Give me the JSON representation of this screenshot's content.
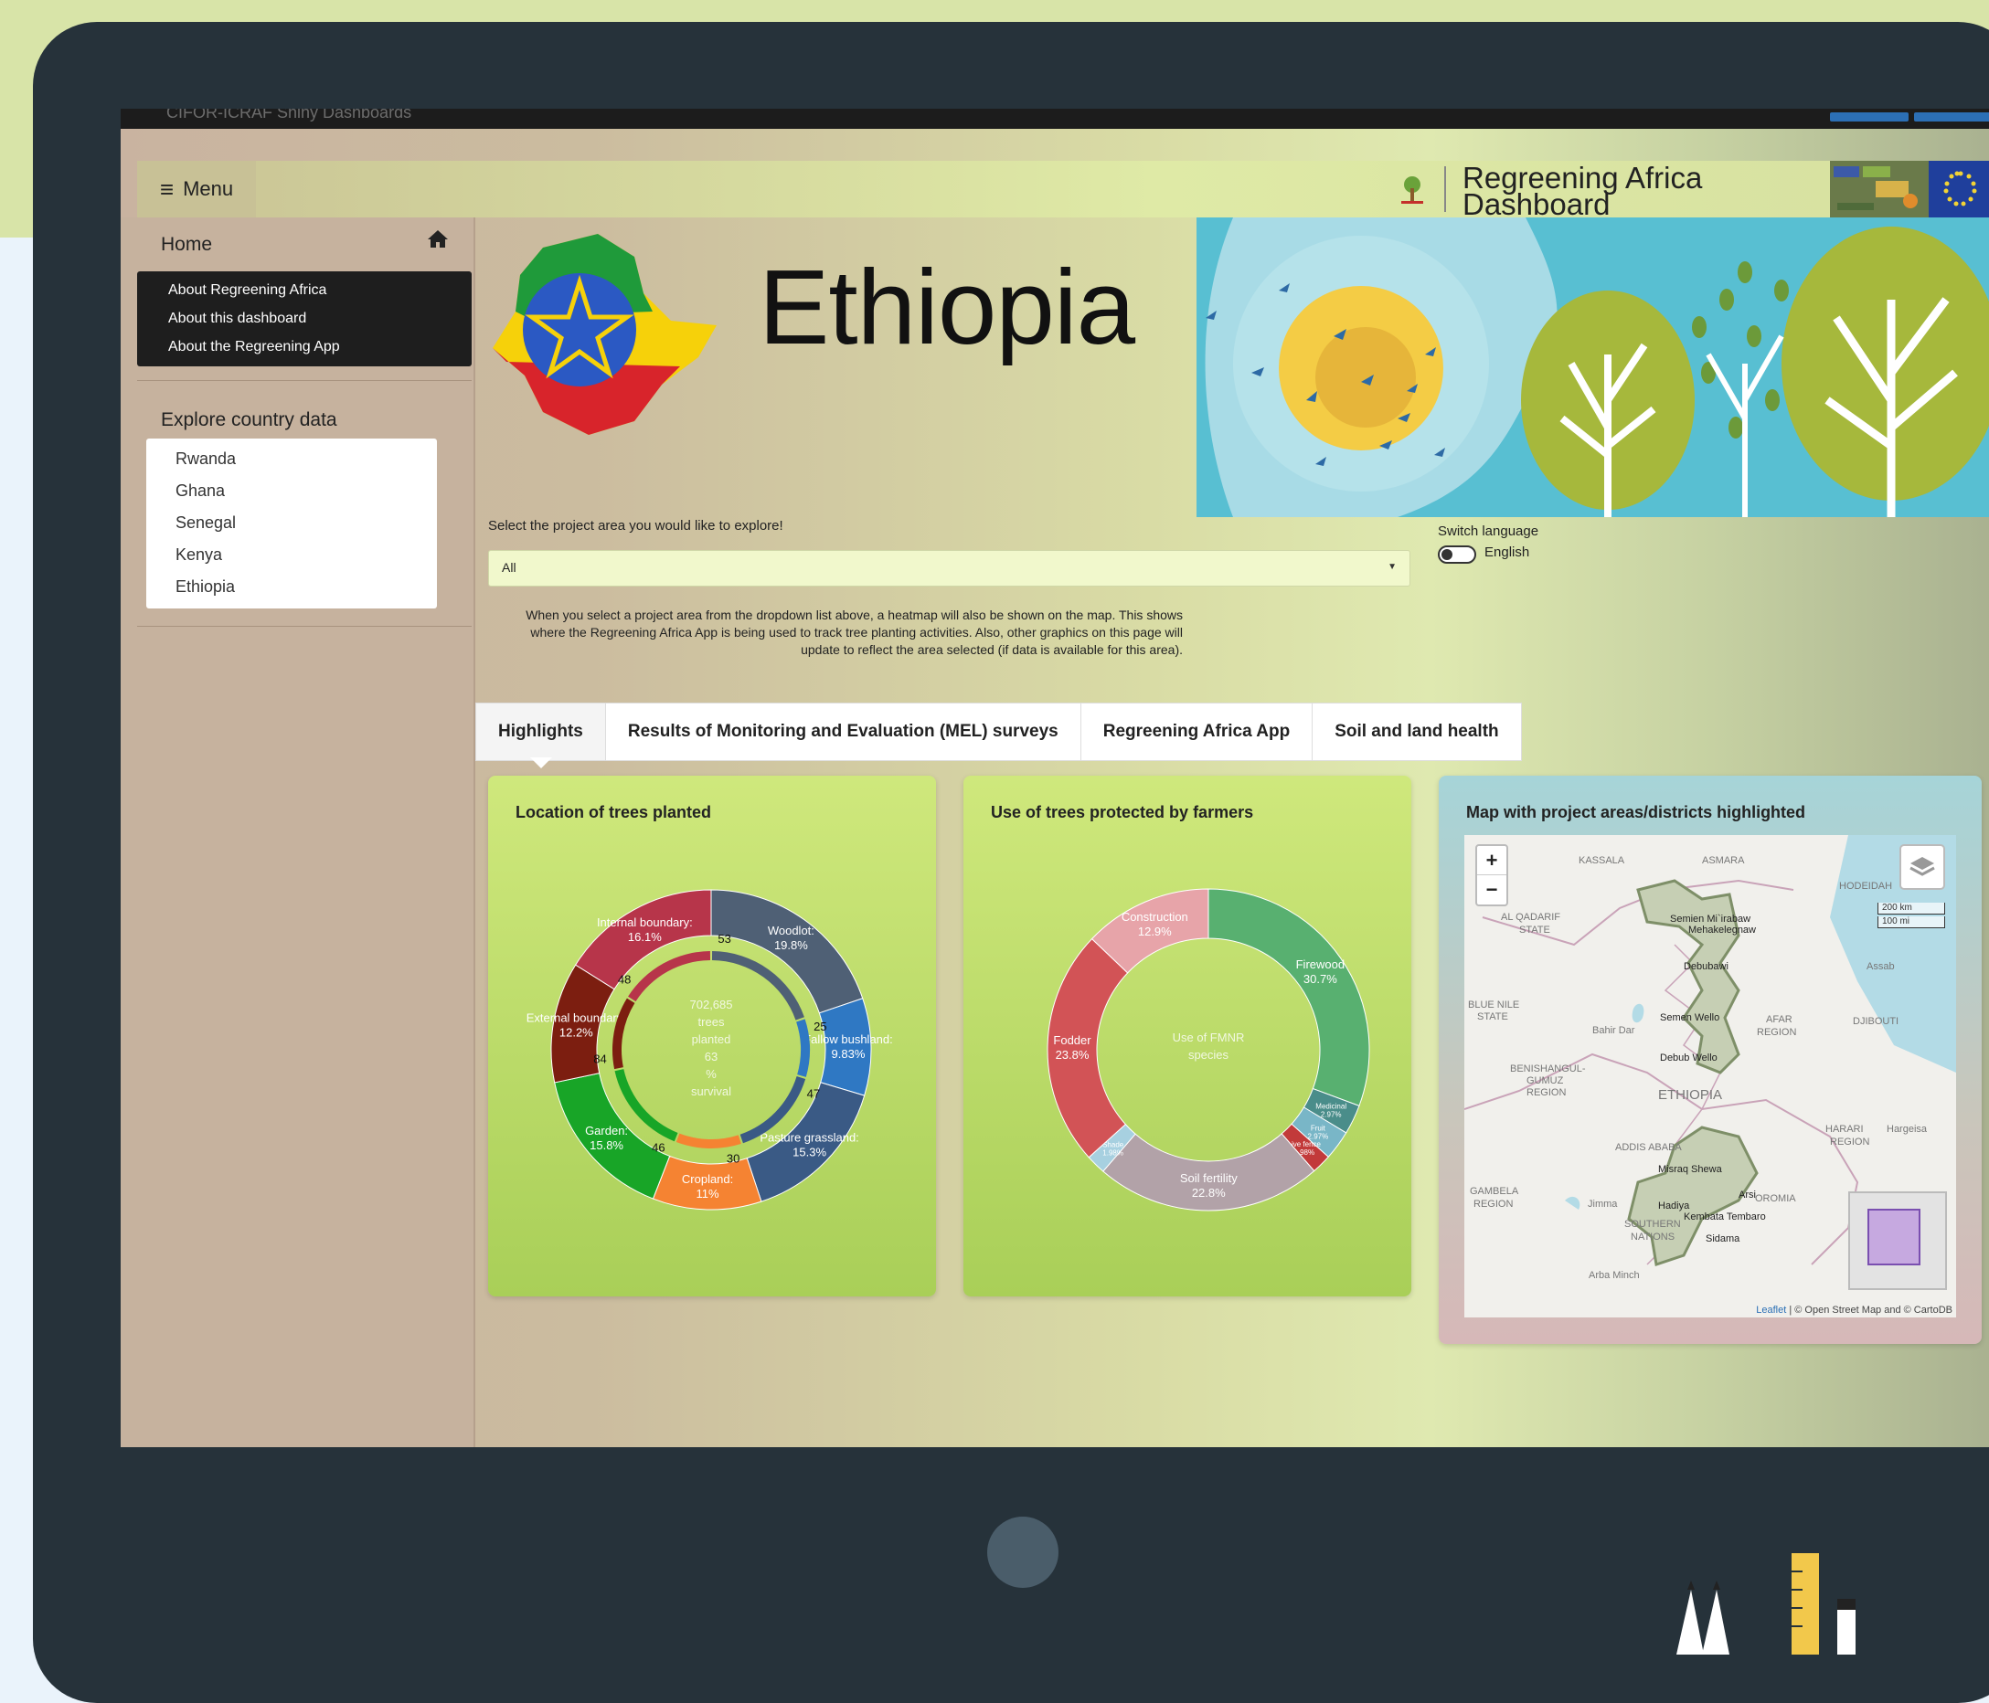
{
  "browser": {
    "title": "CIFOR-ICRAF Shiny Dashboards"
  },
  "navbar": {
    "menu_label": "Menu",
    "title_line1": "Regreening Africa",
    "title_line2": "Dashboard"
  },
  "sidebar": {
    "home_label": "Home",
    "about_items": [
      "About Regreening Africa",
      "About this dashboard",
      "About the Regreening App"
    ],
    "explore_label": "Explore country data",
    "countries": [
      "Rwanda",
      "Ghana",
      "Senegal",
      "Kenya",
      "Ethiopia"
    ]
  },
  "banner": {
    "country": "Ethiopia"
  },
  "controls": {
    "select_label": "Select the project area you would like to explore!",
    "select_value": "All",
    "switch_label": "Switch language",
    "switch_value": "English",
    "note": "When you select a project area from the dropdown list above, a heatmap will also be shown on the map. This shows where the Regreening Africa App is being used to track tree planting activities. Also, other graphics on this page will update to reflect the area selected (if data is available for this area)."
  },
  "tabs": [
    {
      "label": "Highlights",
      "active": true
    },
    {
      "label": "Results of Monitoring and Evaluation (MEL) surveys",
      "active": false
    },
    {
      "label": "Regreening Africa App",
      "active": false
    },
    {
      "label": "Soil and land health",
      "active": false
    }
  ],
  "cards": {
    "card1_title": "Location of trees planted",
    "card2_title": "Use of trees protected by farmers",
    "card3_title": "Map with project areas/districts highlighted"
  },
  "chart_data": [
    {
      "type": "pie",
      "center_text": [
        "702,685",
        "trees",
        "planted",
        "63",
        "%",
        "survival"
      ],
      "slices": [
        {
          "label": "Woodlot:",
          "pct": "19.8%",
          "value": 19.8,
          "survival": 53,
          "color": "#4f6075"
        },
        {
          "label": "Fallow bushland:",
          "pct": "9.83%",
          "value": 9.83,
          "survival": 25,
          "color": "#2f78c3"
        },
        {
          "label": "Pasture grassland:",
          "pct": "15.3%",
          "value": 15.3,
          "survival": 47,
          "color": "#3a5a85"
        },
        {
          "label": "Cropland:",
          "pct": "11%",
          "value": 11.0,
          "survival": 30,
          "color": "#f58332"
        },
        {
          "label": "Garden:",
          "pct": "15.8%",
          "value": 15.8,
          "survival": 46,
          "color": "#18a527"
        },
        {
          "label": "External boundary:",
          "pct": "12.2%",
          "value": 12.2,
          "survival": 84,
          "color": "#7c1e10"
        },
        {
          "label": "Internal boundary:",
          "pct": "16.1%",
          "value": 16.1,
          "survival": 48,
          "color": "#b7354a"
        }
      ]
    },
    {
      "type": "pie",
      "center_text": [
        "Use of FMNR",
        "species"
      ],
      "slices": [
        {
          "label": "Firewood",
          "pct": "30.7%",
          "value": 30.7,
          "color": "#58b070"
        },
        {
          "label": "Medicinal",
          "pct": "2.97%",
          "value": 2.97,
          "color": "#4a8d8a"
        },
        {
          "label": "Fruit",
          "pct": "2.97%",
          "value": 2.97,
          "color": "#79b6c7"
        },
        {
          "label": "Live fence",
          "pct": "1.98%",
          "value": 1.98,
          "color": "#c23a3a"
        },
        {
          "label": "Soil fertility",
          "pct": "22.8%",
          "value": 22.8,
          "color": "#b2a2a8"
        },
        {
          "label": "Shade",
          "pct": "1.98%",
          "value": 1.98,
          "color": "#a7d0e0"
        },
        {
          "label": "Fodder",
          "pct": "23.8%",
          "value": 23.8,
          "color": "#d25356"
        },
        {
          "label": "Construction",
          "pct": "12.9%",
          "value": 12.9,
          "color": "#e7a4a9"
        }
      ]
    }
  ],
  "map": {
    "zoom_in": "+",
    "zoom_out": "−",
    "scale_km": "200 km",
    "scale_mi": "100 mi",
    "attribution_leaflet": "Leaflet",
    "attribution_rest": " | © Open Street Map and © CartoDB",
    "labels": [
      "Kassala",
      "Asmara",
      "Hodeidah",
      "AL QADARIF",
      "STATE",
      "Semien Mi`irabaw",
      "Mehakelegnaw",
      "Debubawi",
      "Assab",
      "BLUE NILE",
      "STATE",
      "Semen Wello",
      "Bahir Dar",
      "AFAR",
      "REGION",
      "DJIBOUTI",
      "Debub Wello",
      "BENISHANGUL-",
      "GUMUZ",
      "REGION",
      "ETHIOPIA",
      "ADDIS ABABA",
      "HARARI",
      "REGION",
      "Hargeisa",
      "Misraq Shewa",
      "Arsi",
      "OROMIA",
      "GAMBELA",
      "REGION",
      "Jimma",
      "Sidama",
      "SOUTHERN",
      "NATIONS",
      "Arba Minch",
      "Kembata Tembaro",
      "Hadiya"
    ]
  },
  "colors": {
    "accent": "#2c6fb5",
    "tablet": "#26323a"
  }
}
